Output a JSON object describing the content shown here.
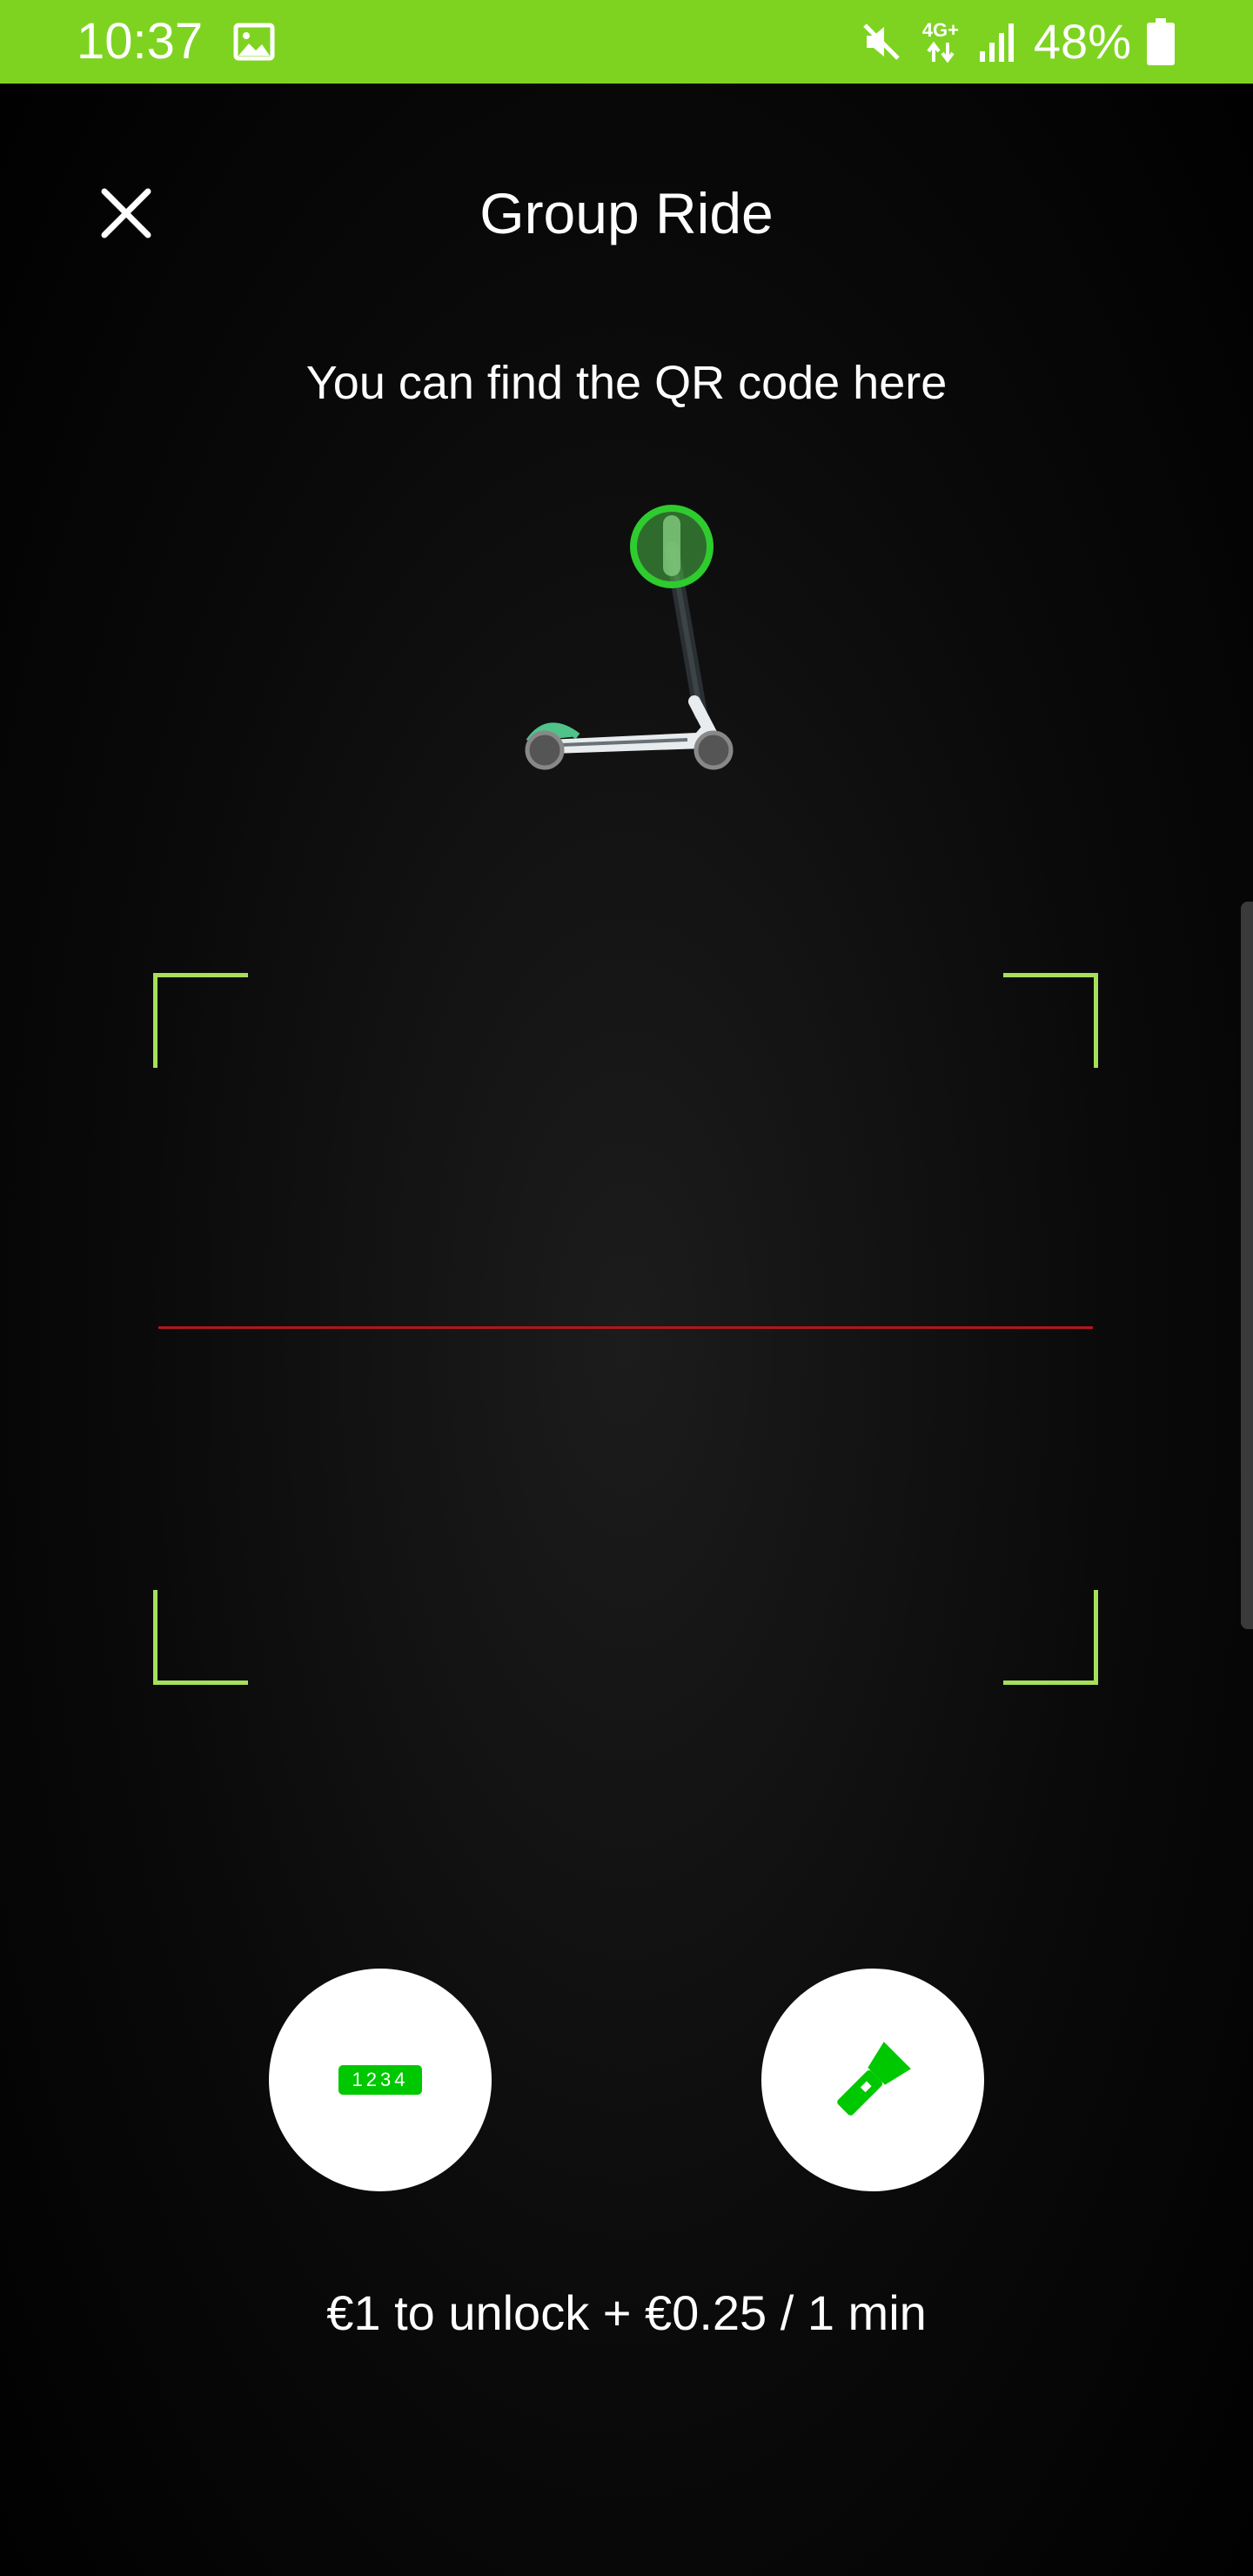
{
  "status_bar": {
    "time": "10:37",
    "battery_percent": "48%",
    "network_label": "4G+",
    "background_color": "#7ed321"
  },
  "header": {
    "title": "Group Ride",
    "close_icon": "close-icon"
  },
  "hint": {
    "text": "You can find the QR code here"
  },
  "scanner": {
    "corner_color": "#a6e05a",
    "scan_line_color": "#b3161a"
  },
  "actions": {
    "enter_code_badge": "1234",
    "enter_code_icon": "keypad-code-icon",
    "flashlight_icon": "flashlight-icon",
    "accent_color": "#00c800"
  },
  "pricing": {
    "text": "€1 to unlock + €0.25 / 1 min"
  }
}
